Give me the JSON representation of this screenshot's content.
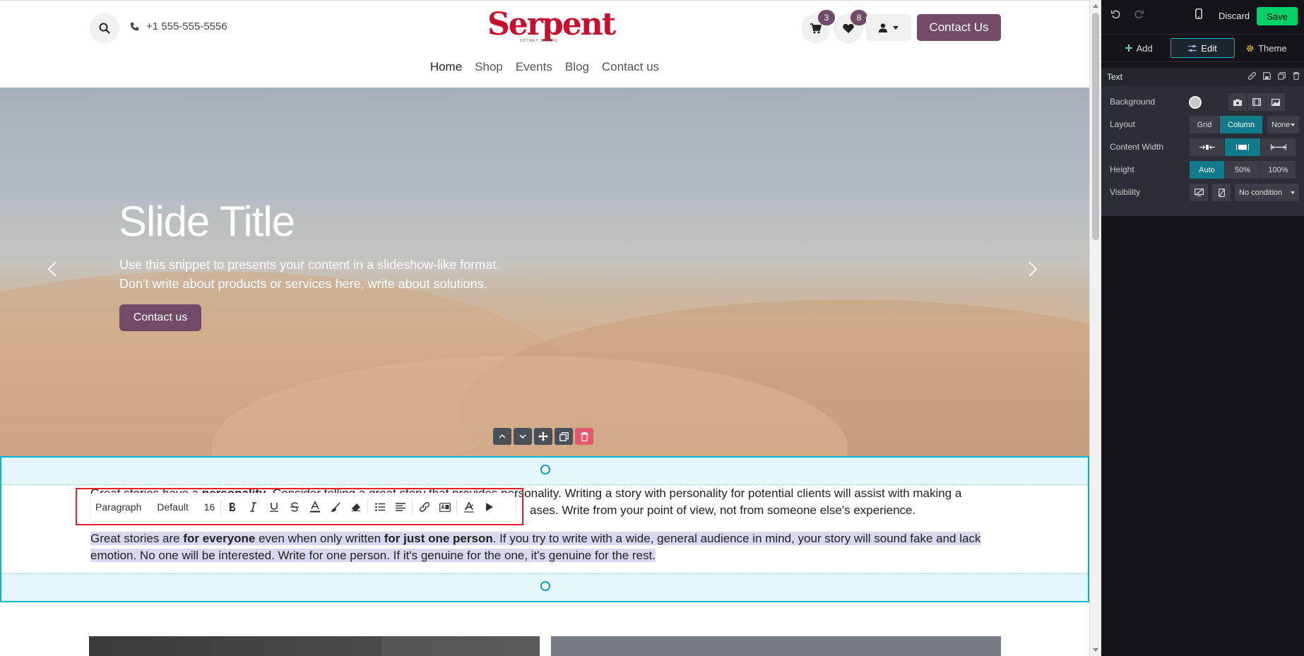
{
  "header": {
    "phone": "+1 555-555-5556",
    "logo_text": "Serpent",
    "logo_sub": "DOTNET STUDIO",
    "cart_count": "3",
    "wishlist_count": "8",
    "contact_button": "Contact Us",
    "nav": [
      "Home",
      "Shop",
      "Events",
      "Blog",
      "Contact us"
    ]
  },
  "hero": {
    "title": "Slide Title",
    "text_line1": "Use this snippet to presents your content in a slideshow-like format.",
    "text_line2": "Don't write about products or services here, write about solutions.",
    "button": "Contact us"
  },
  "content": {
    "p1_a": "Great stories have a ",
    "p1_b": "personality",
    "p1_c": ". Consider telling a great story that provides personality. Writing a story with personality for potential clients will assist with making a",
    "p1_d": "ases. Write from your point of view, not from someone else's experience.",
    "p2_a": "Great stories are ",
    "p2_b": "for everyone",
    "p2_c": " even when only written ",
    "p2_d": "for just one person",
    "p2_e": ". If you try to write with a wide, general audience in mind, your story will sound fake and lack",
    "p2_f": "emotion. No one will be interested. Write for one person. If it's genuine for the one, it's genuine for the rest."
  },
  "toolbar": {
    "style": "Paragraph",
    "font": "Default",
    "size": "16",
    "icons": [
      "bold-icon",
      "italic-icon",
      "underline-icon",
      "strikethrough-icon",
      "font-color-icon",
      "highlight-icon",
      "eraser-icon",
      "list-icon",
      "align-icon",
      "link-icon",
      "translate-icon",
      "text-style-icon",
      "play-icon"
    ]
  },
  "editor": {
    "discard": "Discard",
    "save": "Save",
    "tabs": [
      "Add",
      "Edit",
      "Theme"
    ],
    "section_title": "Text",
    "background_label": "Background",
    "layout_label": "Layout",
    "layout_options": [
      "Grid",
      "Column"
    ],
    "layout_dropdown": "None",
    "content_width_label": "Content Width",
    "height_label": "Height",
    "height_options": [
      "Auto",
      "50%",
      "100%"
    ],
    "visibility_label": "Visibility",
    "visibility_dropdown": "No condition"
  },
  "colors": {
    "brand": "#714b67",
    "accent": "#01bad2",
    "save": "#00d26a",
    "logo": "#c8102e"
  }
}
